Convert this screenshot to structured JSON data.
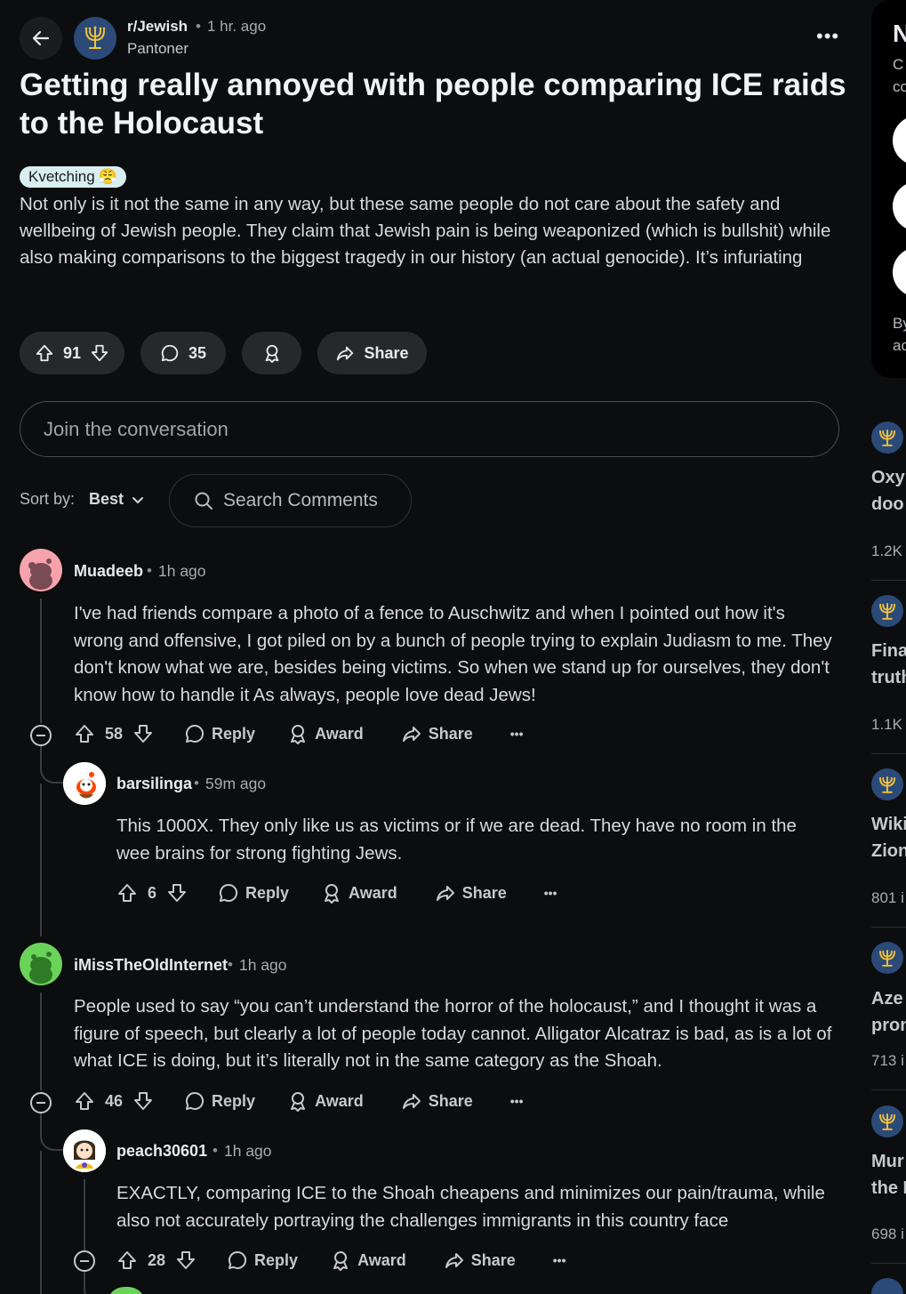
{
  "post": {
    "subreddit": "r/Jewish",
    "time": "1 hr. ago",
    "author": "Pantoner",
    "title": "Getting really annoyed with people comparing ICE raids to the Holocaust",
    "flair": "Kvetching",
    "flair_emoji": "😤",
    "body": "Not only is it not the same in any way, but these same people do not care about the safety and wellbeing of Jewish people. They claim that Jewish pain is being weaponized (which is bullshit) while also making comparisons to the biggest tragedy in our history (an actual genocide). It’s infuriating",
    "votes": "91",
    "comments": "35",
    "share_label": "Share",
    "more": "•••"
  },
  "composer": {
    "placeholder": "Join the conversation"
  },
  "sort": {
    "label": "Sort by:",
    "value": "Best",
    "search_placeholder": "Search Comments"
  },
  "comments": [
    {
      "author": "Muadeeb",
      "time": "1h ago",
      "text": "I've had friends compare a photo of a fence to Auschwitz and when I pointed out how it's wrong and offensive, I got piled on by a bunch of people trying to explain Judiasm to me. They don't know what we are, besides being victims. So when we stand up for ourselves, they don't know how to handle it As always, people love dead Jews!",
      "votes": "58",
      "reply": "Reply",
      "award": "Award",
      "share": "Share",
      "more": "•••"
    },
    {
      "author": "barsilinga",
      "time": "59m ago",
      "text": "This 1000X. They only like us as victims or if we are dead. They have no room in the wee brains for strong fighting Jews.",
      "votes": "6",
      "reply": "Reply",
      "award": "Award",
      "share": "Share",
      "more": "•••"
    },
    {
      "author": "iMissTheOldInternet",
      "time": "1h ago",
      "text": "People used to say “you can’t understand the horror of the holocaust,” and I thought it was a figure of speech, but clearly a lot of people today cannot. Alligator Alcatraz is bad, as is a lot of what ICE is doing, but it’s literally not in the same category as the Shoah.",
      "votes": "46",
      "reply": "Reply",
      "award": "Award",
      "share": "Share",
      "more": "•••"
    },
    {
      "author": "peach30601",
      "time": "1h ago",
      "text": "EXACTLY, comparing ICE to the Shoah cheapens and minimizes our pain/trauma, while also not accurately portraying the challenges immigrants in this country face",
      "votes": "28",
      "reply": "Reply",
      "award": "Award",
      "share": "Share",
      "more": "•••"
    }
  ],
  "right_panel": {
    "card": {
      "heading": "N",
      "line1": "C",
      "line2": "co",
      "footer1": "By",
      "footer2": "ac"
    },
    "posts": [
      {
        "title1": "Oxy",
        "title2": "doo",
        "count": "1.2K"
      },
      {
        "title1": "Fina",
        "title2": "truth",
        "count": "1.1K"
      },
      {
        "title1": "Wiki",
        "title2": "Zion",
        "count": "801 i"
      },
      {
        "title1": "Aze",
        "title2": "pron",
        "count": "713 i"
      },
      {
        "title1": "Mur",
        "title2": "the I",
        "count": "698 i"
      }
    ]
  },
  "colors": {
    "subreddit_icon_bg": "#2b4a78",
    "menorah": "#f0c23a",
    "flair_bg": "#d9eef1",
    "pill_bg": "#26292c"
  }
}
